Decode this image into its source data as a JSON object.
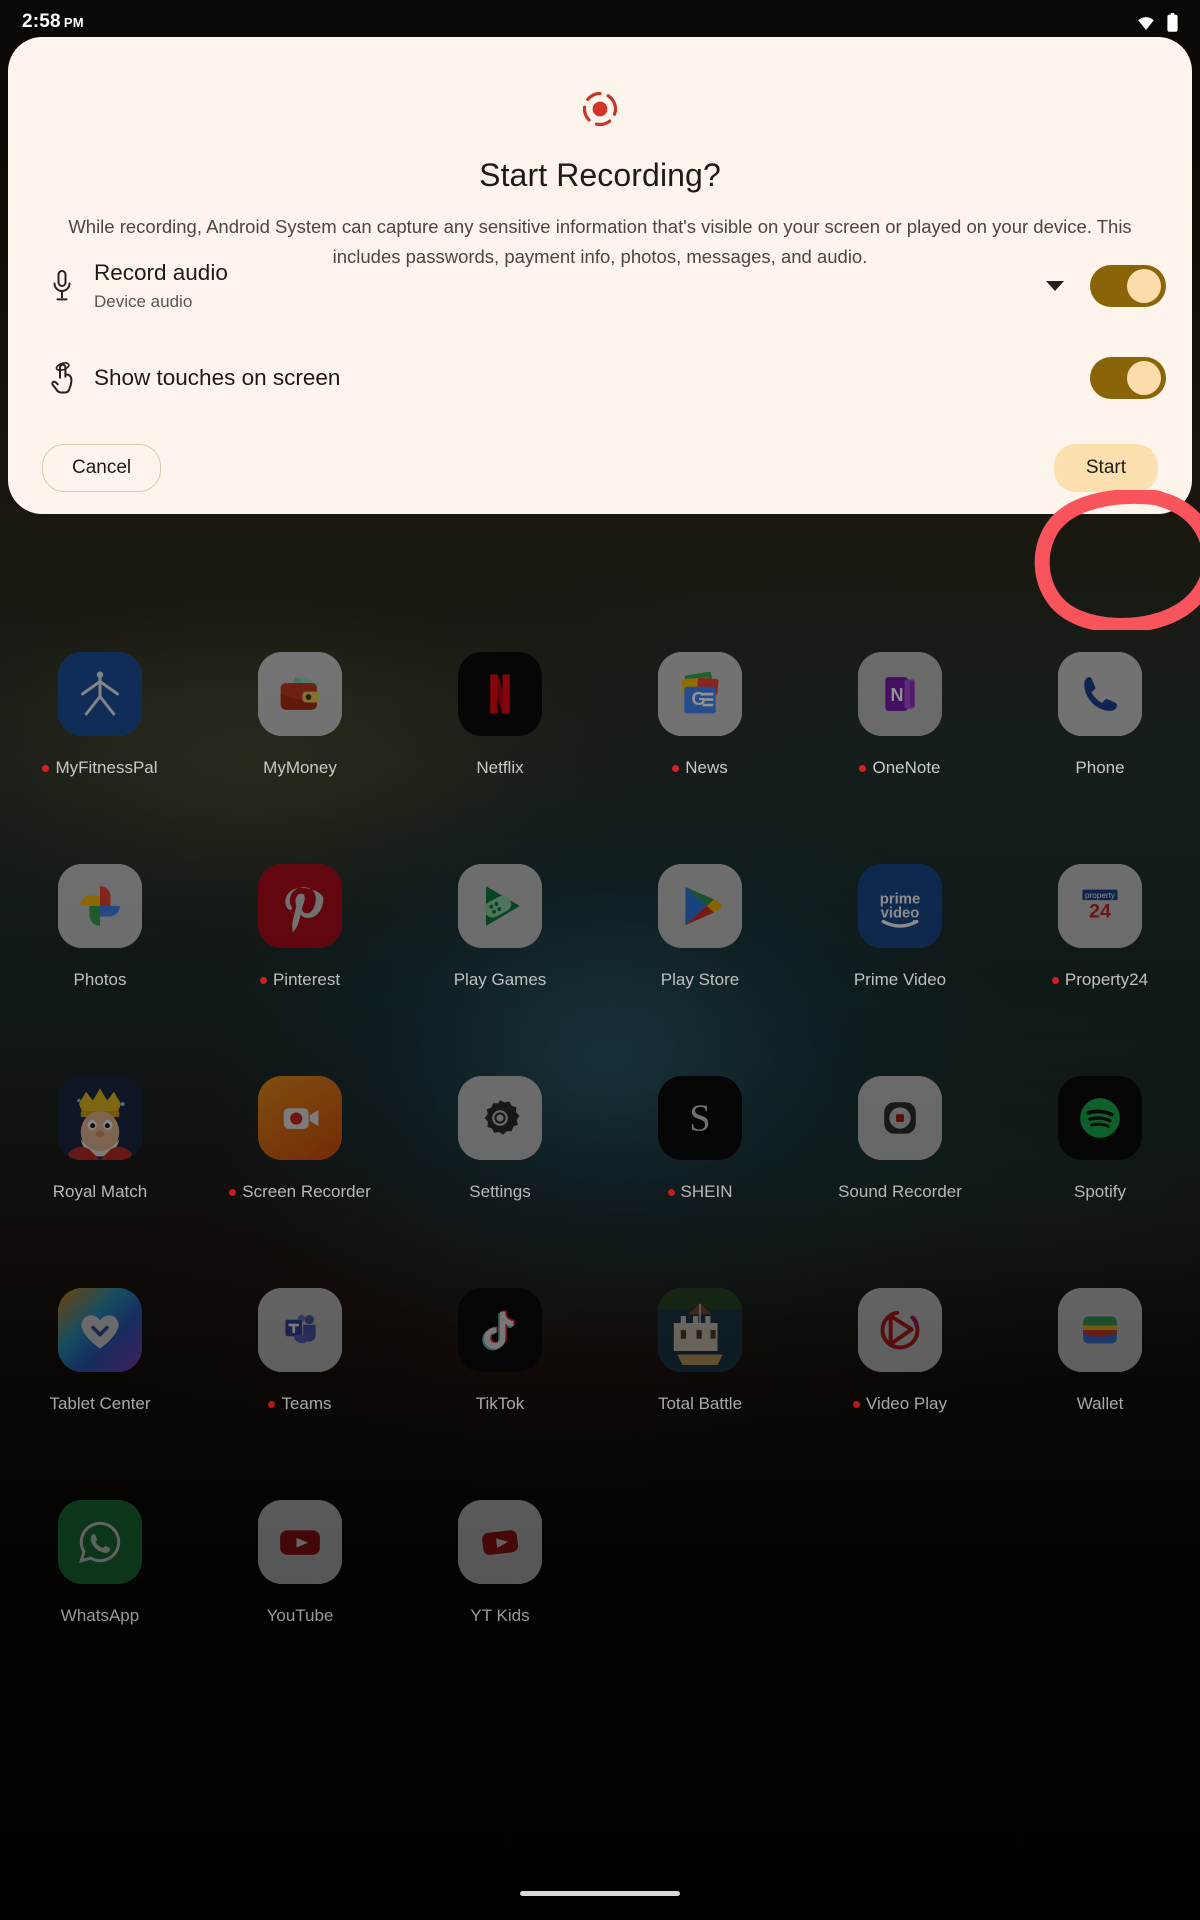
{
  "status_bar": {
    "time": "2:58",
    "meridiem": "PM",
    "wifi_icon": "wifi-icon",
    "battery_icon": "battery-icon"
  },
  "dialog": {
    "record_icon": "screen-record-icon",
    "title": "Start Recording?",
    "description": "While recording, Android System can capture any sensitive information that's visible on your screen or played on your device. This includes passwords, payment info, photos, messages, and audio.",
    "options": [
      {
        "icon": "microphone-icon",
        "title": "Record audio",
        "subtitle": "Device audio",
        "has_dropdown": true,
        "dropdown_icon": "chevron-down-icon",
        "toggle_on": true
      },
      {
        "icon": "touch-pointer-icon",
        "title": "Show touches on screen",
        "subtitle": "",
        "has_dropdown": false,
        "toggle_on": true
      }
    ],
    "cancel_label": "Cancel",
    "start_label": "Start",
    "colors": {
      "surface": "#fdf4ec",
      "toggle_track": "#8a6409",
      "toggle_knob": "#fcdcaa",
      "start_bg": "#fbdfae",
      "record_red": "#c5372c",
      "annotation_red": "#f9545c"
    }
  },
  "annotation": {
    "shape": "hand-drawn-circle",
    "target": "Start",
    "color": "#f9545c"
  },
  "home_screen": {
    "apps": [
      {
        "label": "MyFitnessPal",
        "icon": "myfitnesspal-icon",
        "badge": true
      },
      {
        "label": "MyMoney",
        "icon": "mymoney-icon",
        "badge": false
      },
      {
        "label": "Netflix",
        "icon": "netflix-icon",
        "badge": false
      },
      {
        "label": "News",
        "icon": "google-news-icon",
        "badge": true
      },
      {
        "label": "OneNote",
        "icon": "onenote-icon",
        "badge": true
      },
      {
        "label": "Phone",
        "icon": "phone-icon",
        "badge": false
      },
      {
        "label": "Photos",
        "icon": "google-photos-icon",
        "badge": false
      },
      {
        "label": "Pinterest",
        "icon": "pinterest-icon",
        "badge": true
      },
      {
        "label": "Play Games",
        "icon": "play-games-icon",
        "badge": false
      },
      {
        "label": "Play Store",
        "icon": "play-store-icon",
        "badge": false
      },
      {
        "label": "Prime Video",
        "icon": "prime-video-icon",
        "badge": false
      },
      {
        "label": "Property24",
        "icon": "property24-icon",
        "badge": true
      },
      {
        "label": "Royal Match",
        "icon": "royal-match-icon",
        "badge": false
      },
      {
        "label": "Screen Recorder",
        "icon": "screen-recorder-icon",
        "badge": true
      },
      {
        "label": "Settings",
        "icon": "settings-icon",
        "badge": false
      },
      {
        "label": "SHEIN",
        "icon": "shein-icon",
        "badge": true
      },
      {
        "label": "Sound Recorder",
        "icon": "sound-recorder-icon",
        "badge": false
      },
      {
        "label": "Spotify",
        "icon": "spotify-icon",
        "badge": false
      },
      {
        "label": "Tablet Center",
        "icon": "tablet-center-icon",
        "badge": false
      },
      {
        "label": "Teams",
        "icon": "teams-icon",
        "badge": true
      },
      {
        "label": "TikTok",
        "icon": "tiktok-icon",
        "badge": false
      },
      {
        "label": "Total Battle",
        "icon": "total-battle-icon",
        "badge": false
      },
      {
        "label": "Video Play",
        "icon": "video-play-icon",
        "badge": true
      },
      {
        "label": "Wallet",
        "icon": "wallet-icon",
        "badge": false
      },
      {
        "label": "WhatsApp",
        "icon": "whatsapp-icon",
        "badge": false
      },
      {
        "label": "YouTube",
        "icon": "youtube-icon",
        "badge": false
      },
      {
        "label": "YT Kids",
        "icon": "yt-kids-icon",
        "badge": false
      }
    ]
  },
  "nav_bar": {
    "gesture_handle": "home-gesture-pill"
  }
}
